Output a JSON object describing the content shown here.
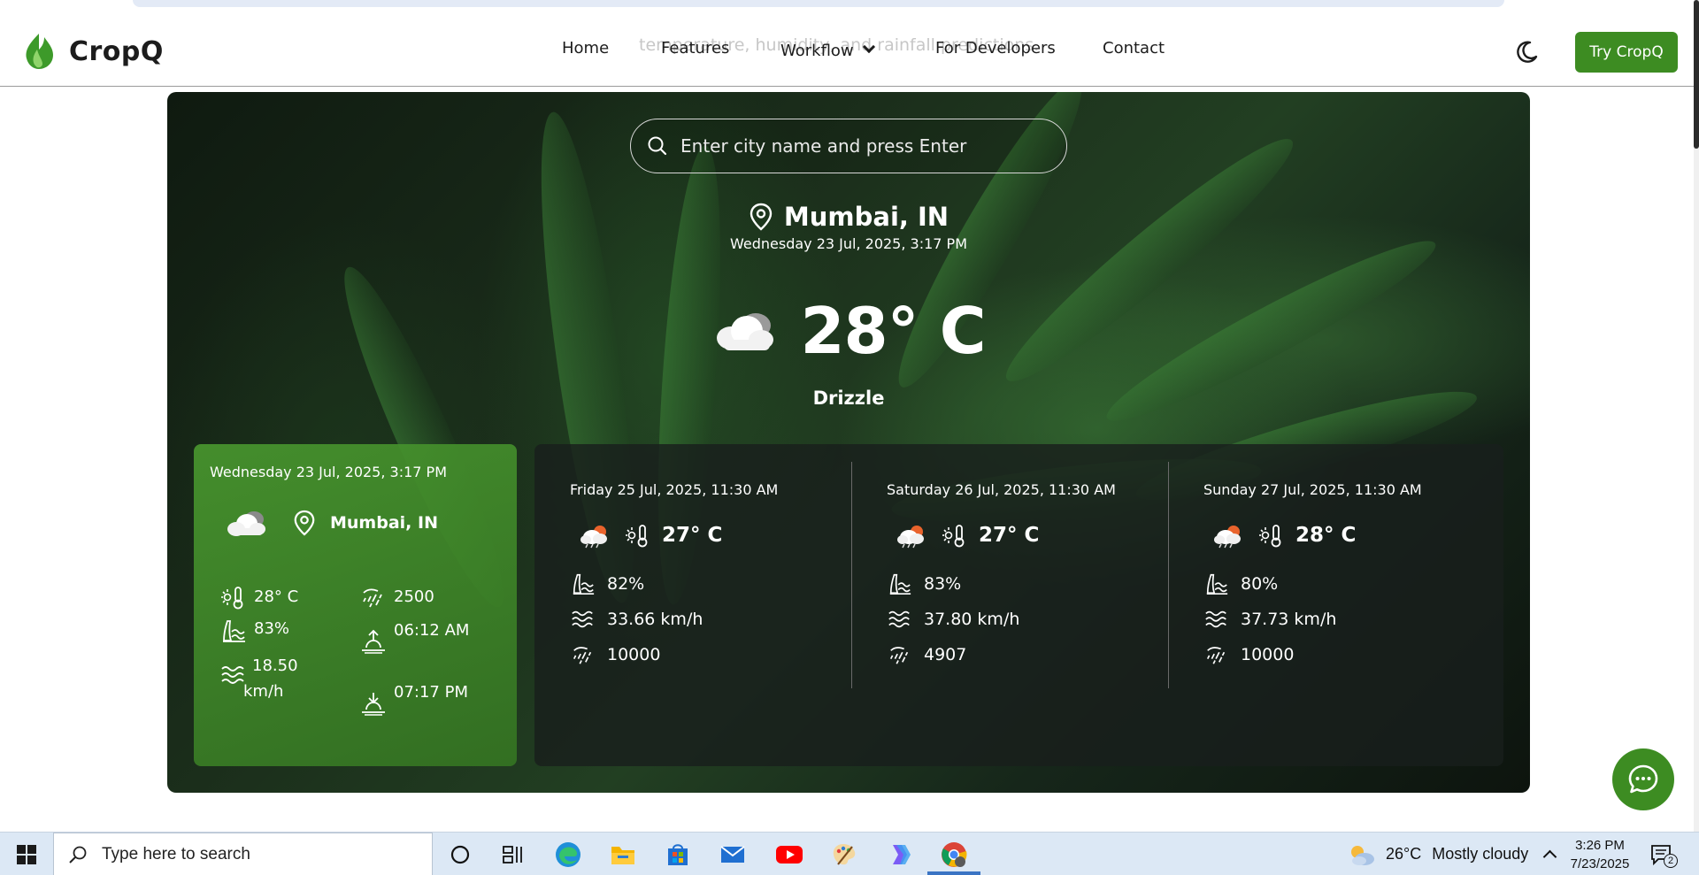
{
  "colors": {
    "brand_green": "#3d8c22",
    "card_green": "#48962e",
    "forecast_bg": "#191e1c"
  },
  "page": {
    "ghost_text": "temperature, humidity, and rainfall predictions."
  },
  "brand": {
    "name": "CropQ",
    "logo_icon": "leaf-flame-icon"
  },
  "nav": {
    "items": [
      {
        "label": "Home"
      },
      {
        "label": "Features"
      },
      {
        "label": "Workflow"
      },
      {
        "label": "For Developers"
      },
      {
        "label": "Contact"
      }
    ],
    "theme_icon": "moon-icon",
    "cta_label": "Try CropQ"
  },
  "weather": {
    "search_placeholder": "Enter city name and press Enter",
    "city": "Mumbai, IN",
    "datetime": "Wednesday 23 Jul, 2025, 3:17 PM",
    "temperature": "28° C",
    "condition": "Drizzle",
    "condition_icon": "cloud-icon"
  },
  "today": {
    "datetime": "Wednesday 23 Jul, 2025, 3:17 PM",
    "city": "Mumbai, IN",
    "temperature": "28° C",
    "humidity": "83%",
    "wind_speed": "18.50",
    "wind_unit": "km/h",
    "precipitation": "2500",
    "sunrise": "06:12 AM",
    "sunset": "07:17 PM"
  },
  "forecast": [
    {
      "datetime": "Friday 25 Jul, 2025, 11:30 AM",
      "temperature": "27° C",
      "humidity": "82%",
      "wind": "33.66 km/h",
      "precipitation": "10000"
    },
    {
      "datetime": "Saturday 26 Jul, 2025, 11:30 AM",
      "temperature": "27° C",
      "humidity": "83%",
      "wind": "37.80 km/h",
      "precipitation": "4907"
    },
    {
      "datetime": "Sunday 27 Jul, 2025, 11:30 AM",
      "temperature": "28° C",
      "humidity": "80%",
      "wind": "37.73 km/h",
      "precipitation": "10000"
    }
  ],
  "taskbar": {
    "search_placeholder": "Type here to search",
    "weather_temp": "26°C",
    "weather_text": "Mostly cloudy",
    "time": "3:26 PM",
    "date": "7/23/2025",
    "notification_count": "2"
  }
}
